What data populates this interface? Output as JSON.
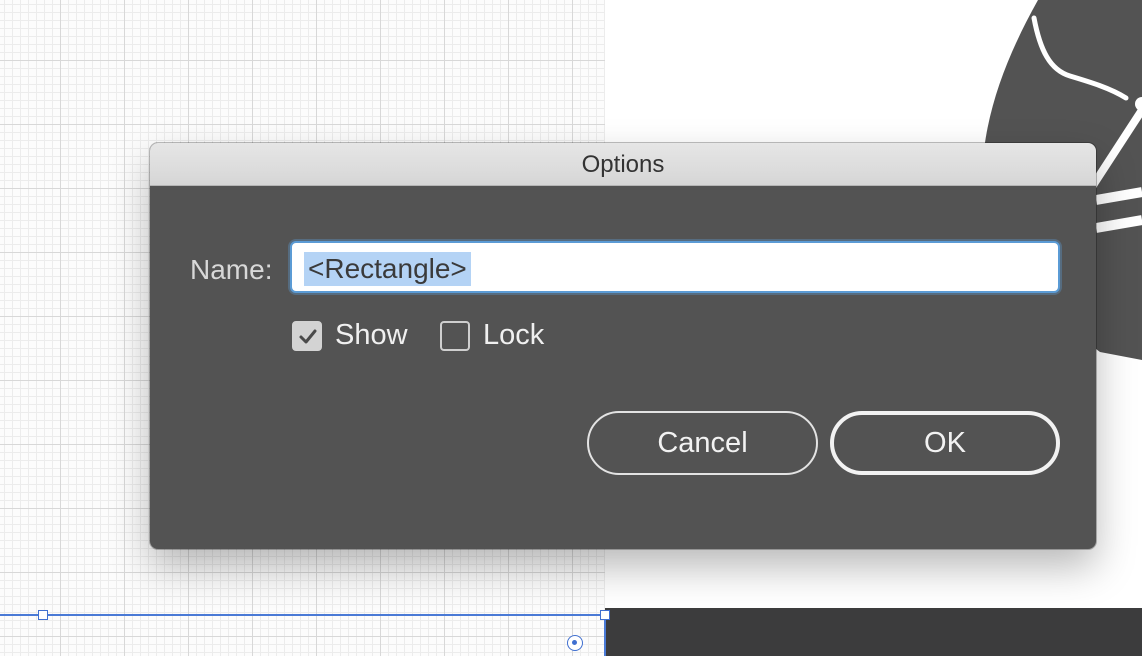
{
  "dialog": {
    "title": "Options",
    "name_label": "Name:",
    "name_value": "<Rectangle>",
    "show_label": "Show",
    "show_checked": true,
    "lock_label": "Lock",
    "lock_checked": false,
    "cancel_label": "Cancel",
    "ok_label": "OK"
  },
  "colors": {
    "dialog_bg": "#535353",
    "titlebar": "#dcdcdc",
    "selection_accent": "#3f6fd0",
    "text_highlight": "#b4d3f5",
    "artwork_fill": "#535353"
  },
  "icons": {
    "show_checkbox": "checkmark-icon",
    "center_point": "center-point-icon"
  }
}
